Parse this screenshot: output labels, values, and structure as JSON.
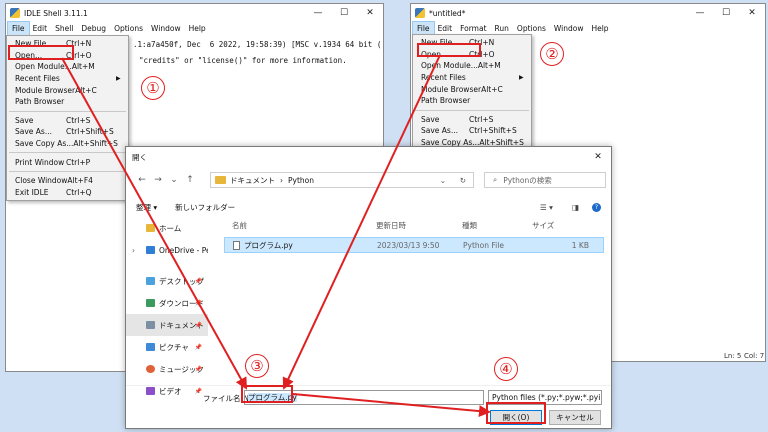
{
  "shell": {
    "title": "IDLE Shell 3.11.1",
    "menus": [
      "File",
      "Edit",
      "Shell",
      "Debug",
      "Options",
      "Window",
      "Help"
    ],
    "text_line1": ".1:a7a450f, Dec  6 2022, 19:58:39) [MSC v.1934 64 bit (",
    "text_line2": "\"credits\" or \"license()\" for more information.",
    "menu_items": [
      {
        "label": "New File",
        "accel": "Ctrl+N"
      },
      {
        "label": "Open...",
        "accel": "Ctrl+O"
      },
      {
        "label": "Open Module...",
        "accel": "Alt+M"
      },
      {
        "label": "Recent Files",
        "accel": "",
        "submenu": true
      },
      {
        "label": "Module Browser",
        "accel": "Alt+C"
      },
      {
        "label": "Path Browser",
        "accel": ""
      },
      {
        "label": "Save",
        "accel": "Ctrl+S"
      },
      {
        "label": "Save As...",
        "accel": "Ctrl+Shift+S"
      },
      {
        "label": "Save Copy As...",
        "accel": "Alt+Shift+S"
      },
      {
        "label": "Print Window",
        "accel": "Ctrl+P"
      },
      {
        "label": "Close Window",
        "accel": "Alt+F4"
      },
      {
        "label": "Exit IDLE",
        "accel": "Ctrl+Q"
      }
    ]
  },
  "editor": {
    "title": "*untitled*",
    "menus": [
      "File",
      "Edit",
      "Format",
      "Run",
      "Options",
      "Window",
      "Help"
    ],
    "status_ln": "Ln: 5",
    "status_col": "Col: 7",
    "menu_items": [
      {
        "label": "New File",
        "accel": "Ctrl+N"
      },
      {
        "label": "Open...",
        "accel": "Ctrl+O"
      },
      {
        "label": "Open Module...",
        "accel": "Alt+M"
      },
      {
        "label": "Recent Files",
        "accel": "",
        "submenu": true
      },
      {
        "label": "Module Browser",
        "accel": "Alt+C"
      },
      {
        "label": "Path Browser",
        "accel": ""
      },
      {
        "label": "Save",
        "accel": "Ctrl+S"
      },
      {
        "label": "Save As...",
        "accel": "Ctrl+Shift+S"
      },
      {
        "label": "Save Copy As...",
        "accel": "Alt+Shift+S"
      }
    ]
  },
  "steps": [
    "①",
    "②",
    "③",
    "④"
  ],
  "dialog": {
    "title": "開く",
    "path": [
      "ドキュメント",
      "›",
      "Python"
    ],
    "search_placeholder": "Pythonの検索",
    "organize": "整理 ▾",
    "new_folder": "新しいフォルダー",
    "sidebar": [
      {
        "label": "ホーム",
        "color": "#e8b73a"
      },
      {
        "label": "OneDrive - Pers",
        "color": "#2f7fd6",
        "chevron": true
      },
      {
        "label": "デスクトップ",
        "color": "#4aa3df",
        "pin": true
      },
      {
        "label": "ダウンロード",
        "color": "#3a9b5c",
        "pin": true
      },
      {
        "label": "ドキュメント",
        "color": "#7d8fa3",
        "pin": true,
        "selected": true
      },
      {
        "label": "ピクチャ",
        "color": "#3c8ad8",
        "pin": true
      },
      {
        "label": "ミュージック",
        "color": "#e0603a",
        "pin": true
      },
      {
        "label": "ビデオ",
        "color": "#8b4fc8",
        "pin": true
      }
    ],
    "columns": {
      "name": "名前",
      "date": "更新日時",
      "type": "種類",
      "size": "サイズ"
    },
    "files": [
      {
        "name": "プログラム.py",
        "date": "2023/03/13 9:50",
        "type": "Python File",
        "size": "1 KB"
      }
    ],
    "filename_label": "ファイル名(N):",
    "filename_value": "プログラム.py",
    "filter": "Python files (*.py;*.pyw;*.pyi)",
    "open_button": "開く(O)",
    "cancel_button": "キャンセル"
  },
  "colors": {
    "annotation": "#e02020",
    "selection": "#cce8ff"
  }
}
